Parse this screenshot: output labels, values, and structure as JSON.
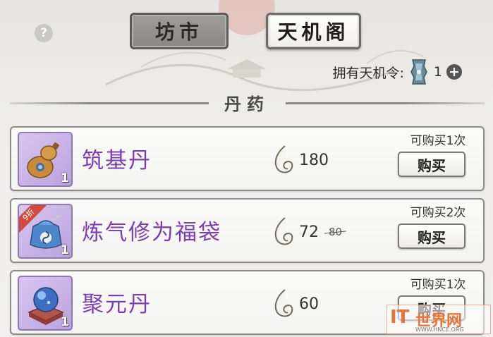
{
  "header": {
    "help_icon": "?",
    "tabs": [
      {
        "label": "坊市",
        "active": false
      },
      {
        "label": "天机阁",
        "active": true
      }
    ],
    "token_label": "拥有天机令:",
    "token_count": "1",
    "add_icon": "+"
  },
  "section": {
    "title": "丹药"
  },
  "items": [
    {
      "name": "筑基丹",
      "price": "180",
      "old_price": "",
      "limit": "可购买1次",
      "buy_label": "购买",
      "qty": "1",
      "discount": "",
      "icon": "gourd-icon"
    },
    {
      "name": "炼气修为福袋",
      "price": "72",
      "old_price": "80",
      "limit": "可购买2次",
      "buy_label": "购买",
      "qty": "1",
      "discount": "9折",
      "icon": "lucky-bag-icon"
    },
    {
      "name": "聚元丹",
      "price": "60",
      "old_price": "",
      "limit": "可购买1次",
      "buy_label": "购买",
      "qty": "1",
      "discount": "",
      "icon": "spirit-orb-icon"
    }
  ],
  "watermark": {
    "brand": "IT",
    "text": "世界网",
    "url": "WWW.HNCE.ORG"
  },
  "colors": {
    "item_name": "#7b3fb0",
    "thumb_bg": "#c9b3e8",
    "discount_tag": "#d24a3b",
    "watermark": "#e8743b"
  }
}
